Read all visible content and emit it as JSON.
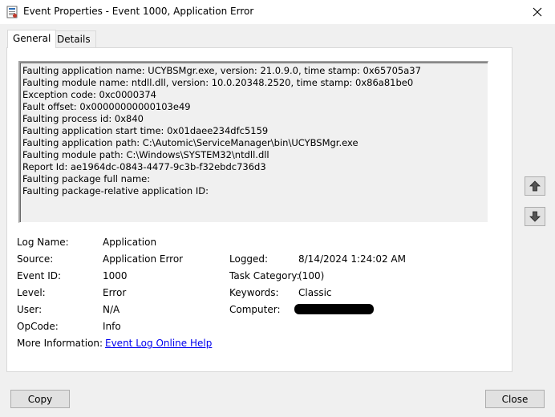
{
  "window": {
    "title": "Event Properties - Event 1000, Application Error"
  },
  "tabs": [
    {
      "label": "General",
      "active": true
    },
    {
      "label": "Details",
      "active": false
    }
  ],
  "description_lines": [
    "Faulting application name: UCYBSMgr.exe, version: 21.0.9.0, time stamp: 0x65705a37",
    "Faulting module name: ntdll.dll, version: 10.0.20348.2520, time stamp: 0x86a81be0",
    "Exception code: 0xc0000374",
    "Fault offset: 0x00000000000103e49",
    "Faulting process id: 0x840",
    "Faulting application start time: 0x01daee234dfc5159",
    "Faulting application path: C:\\Automic\\ServiceManager\\bin\\UCYBSMgr.exe",
    "Faulting module path: C:\\Windows\\SYSTEM32\\ntdll.dll",
    "Report Id: ae1964dc-0843-4477-9c3b-f32ebdc736d3",
    "Faulting package full name:",
    "Faulting package-relative application ID:"
  ],
  "fields": {
    "log_name": {
      "label": "Log Name:",
      "value": "Application"
    },
    "source": {
      "label": "Source:",
      "value": "Application Error"
    },
    "logged": {
      "label": "Logged:",
      "value": "8/14/2024 1:24:02 AM"
    },
    "event_id": {
      "label": "Event ID:",
      "value": "1000"
    },
    "task_category": {
      "label": "Task Category:",
      "value": "(100)"
    },
    "level": {
      "label": "Level:",
      "value": "Error"
    },
    "keywords": {
      "label": "Keywords:",
      "value": "Classic"
    },
    "user": {
      "label": "User:",
      "value": "N/A"
    },
    "computer": {
      "label": "Computer:",
      "value": ""
    },
    "opcode": {
      "label": "OpCode:",
      "value": "Info"
    },
    "more_info": {
      "label": "More Information:",
      "link": "Event Log Online Help"
    }
  },
  "buttons": {
    "copy": "Copy",
    "close": "Close"
  },
  "icons": {
    "close": "close-icon",
    "up": "arrow-up-icon",
    "down": "arrow-down-icon",
    "app": "event-viewer-icon"
  },
  "colors": {
    "link": "#0000ee",
    "window_bg": "#f0f0f0",
    "panel_bg": "#ffffff"
  }
}
